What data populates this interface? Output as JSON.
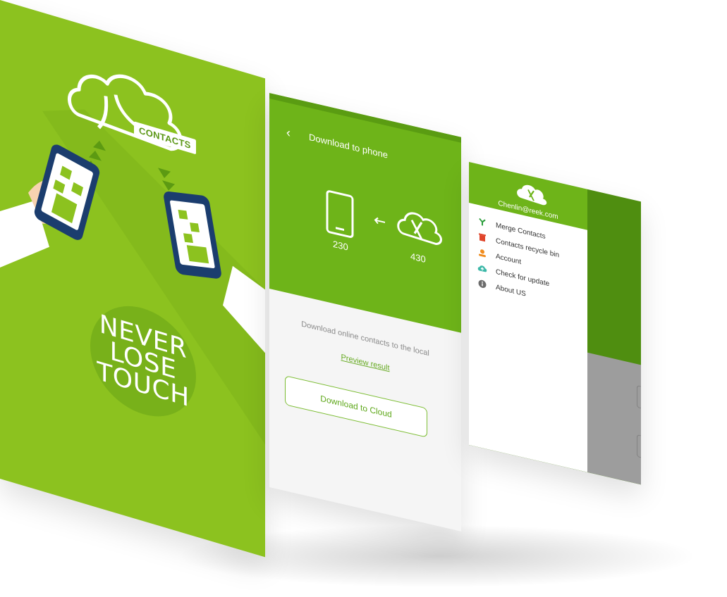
{
  "splash": {
    "logo_label": "CONTACTS",
    "tagline": [
      "NEVER",
      "LOSE",
      "TOUCH"
    ],
    "colors": {
      "background": "#8cc21f",
      "badge": "#78b11a"
    }
  },
  "download_screen": {
    "back_icon": "back-chevron-icon",
    "title": "Download  to phone",
    "phone_count": "230",
    "cloud_count": "430",
    "description": "Download online contacts to the local",
    "preview_link": "Preview result",
    "action_button": "Download to Cloud",
    "colors": {
      "header": "#6eb419",
      "accent": "#5fa81b"
    }
  },
  "menu_screen": {
    "email": "Chenlin@reek.com",
    "items": [
      {
        "label": "Merge Contacts",
        "icon": "merge-icon",
        "color": "#2a9d3a"
      },
      {
        "label": "Contacts recycle bin",
        "icon": "trash-icon",
        "color": "#e0452b"
      },
      {
        "label": "Account",
        "icon": "person-icon",
        "color": "#f08c1e"
      },
      {
        "label": "Check for update",
        "icon": "cloud-upload-icon",
        "color": "#3cb8a8"
      },
      {
        "label": "About US",
        "icon": "info-icon",
        "color": "#6c6c6c"
      }
    ]
  }
}
